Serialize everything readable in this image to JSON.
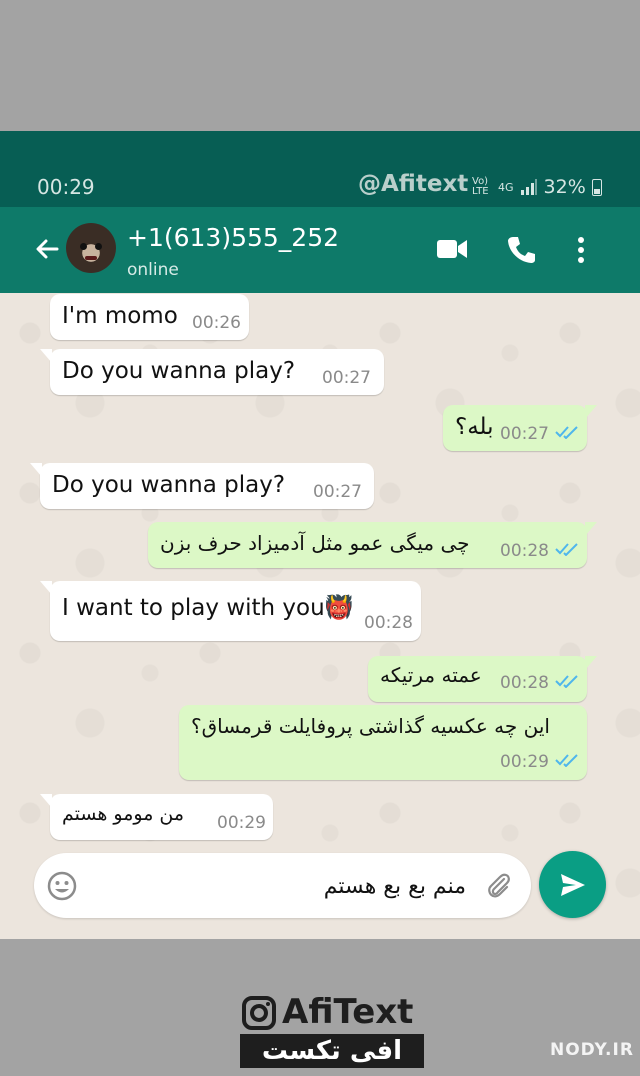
{
  "status_bar": {
    "time": "00:29",
    "watermark": "@Afitext",
    "network_1": "Vo) LTE",
    "network_2": "4G",
    "battery": "32%"
  },
  "header": {
    "contact_name": "+1(613)555_252",
    "contact_status": "online",
    "icons": [
      "back-arrow-icon",
      "avatar",
      "video-call-icon",
      "phone-call-icon",
      "more-menu-icon"
    ]
  },
  "messages": [
    {
      "direction": "in",
      "text": "I'm momo",
      "time": "00:26"
    },
    {
      "direction": "in",
      "text": "Do you wanna play?",
      "time": "00:27"
    },
    {
      "direction": "out",
      "text": "بله؟",
      "time": "00:27",
      "read": true
    },
    {
      "direction": "in",
      "text": "Do you wanna play?",
      "time": "00:27"
    },
    {
      "direction": "out",
      "text": "چی میگی عمو مثل آدمیزاد حرف بزن",
      "time": "00:28",
      "read": true
    },
    {
      "direction": "in",
      "text": "I want to play with you👹",
      "time": "00:28"
    },
    {
      "direction": "out",
      "text": "عمته مرتیکه",
      "time": "00:28",
      "read": true
    },
    {
      "direction": "out",
      "text": "این چه عکسیه گذاشتی پروفایلت قرمساق؟",
      "time": "00:29",
      "read": true
    },
    {
      "direction": "in",
      "text": "من مومو هستم",
      "time": "00:29"
    }
  ],
  "composer": {
    "value": "منم بع بع هستم",
    "icons": [
      "emoji-icon",
      "attach-icon",
      "send-icon"
    ]
  },
  "branding": {
    "name": "AfiText",
    "subtitle": "افی تکست",
    "site": "NODY.IR"
  },
  "colors": {
    "header_dark": "#075e54",
    "header": "#0e7a69",
    "outgoing_bubble": "#dcf8c6",
    "incoming_bubble": "#ffffff",
    "chat_background": "#ece5dd",
    "send_button": "#0a9e84",
    "read_ticks": "#4fb6ec"
  }
}
